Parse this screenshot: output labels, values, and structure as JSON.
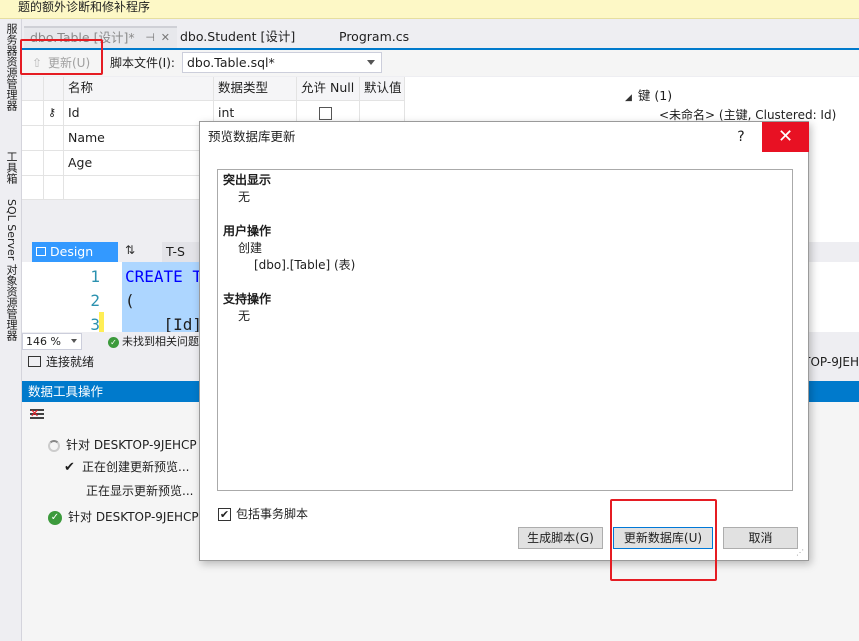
{
  "banner": {
    "text": "题的额外诊断和修补程序"
  },
  "left_strip": {
    "items": [
      "服务器资源管理器",
      "工具箱",
      "SQL Server 对象资源管理器"
    ]
  },
  "tabs": [
    {
      "label": "dbo.Table [设计]*",
      "pin": "⊣",
      "close": "✕"
    },
    {
      "label": "dbo.Student [设计]"
    },
    {
      "label": "Program.cs"
    }
  ],
  "toolbar": {
    "update_label": "更新(U)",
    "script_label": "脚本文件(I):",
    "script_value": "dbo.Table.sql*"
  },
  "grid": {
    "headers": [
      "名称",
      "数据类型",
      "允许 Null",
      "默认值"
    ],
    "rows": [
      {
        "name": "Id",
        "type": "int",
        "nullable": false,
        "key": true
      },
      {
        "name": "Name",
        "type": "",
        "nullable": false,
        "key": false
      },
      {
        "name": "Age",
        "type": "",
        "nullable": false,
        "key": false
      }
    ]
  },
  "props": {
    "key_header": "键 (1)",
    "key_row": "<未命名>  (主键, Clustered: Id)"
  },
  "design_bar": {
    "design_label": "Design",
    "swap_icon": "⇅",
    "tsql_label": "T-S"
  },
  "code": {
    "line_numbers": [
      "1",
      "2",
      "3"
    ],
    "lines": [
      "CREATE T",
      "(",
      "    [Id]"
    ]
  },
  "zoom_bar": {
    "zoom": "146 %",
    "issues": "未找到相关问题"
  },
  "conn_bar": {
    "status": "连接就绪",
    "right_text": "TOP-9JEH"
  },
  "data_tools": {
    "title": "数据工具操作",
    "ops": [
      {
        "text": "针对 DESKTOP-9JEHCP",
        "state": "running"
      },
      {
        "text": "正在创建更新预览...",
        "state": "done-step"
      },
      {
        "text": "正在显示更新预览...",
        "state": "pending-step"
      },
      {
        "text": "针对 DESKTOP-9JEHCP",
        "state": "success"
      }
    ]
  },
  "dialog": {
    "title": "预览数据库更新",
    "help": "?",
    "close": "✕",
    "sections": [
      {
        "heading": "突出显示",
        "items": [
          "无"
        ]
      },
      {
        "heading": "用户操作",
        "items": [
          "创建",
          "[dbo].[Table] (表)"
        ]
      },
      {
        "heading": "支持操作",
        "items": [
          "无"
        ]
      }
    ],
    "include_transactional": {
      "label": "包括事务脚本",
      "checked": true
    },
    "buttons": {
      "generate": "生成脚本(G)",
      "update": "更新数据库(U)",
      "cancel": "取消"
    }
  },
  "colors": {
    "accent": "#007acc",
    "highlight_red": "#e51c23",
    "close_red": "#e81123",
    "design_tab": "#3399ff"
  }
}
